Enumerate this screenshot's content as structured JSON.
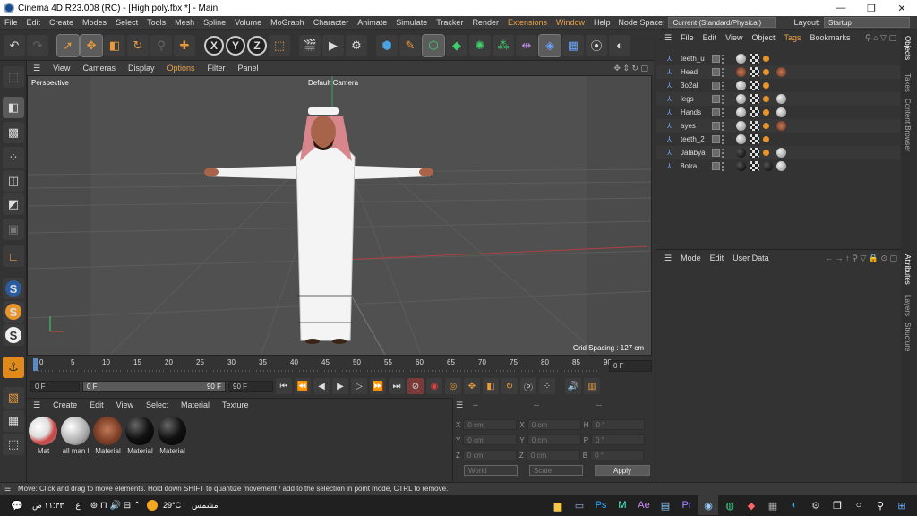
{
  "window": {
    "title": "Cinema 4D R23.008 (RC) - [High poly.fbx *] - Main"
  },
  "menubar": {
    "items": [
      "File",
      "Edit",
      "Create",
      "Modes",
      "Select",
      "Tools",
      "Mesh",
      "Spline",
      "Volume",
      "MoGraph",
      "Character",
      "Animate",
      "Simulate",
      "Tracker",
      "Render",
      "Extensions",
      "Window",
      "Help"
    ],
    "node_space_label": "Node Space:",
    "node_space_value": "Current (Standard/Physical)",
    "layout_label": "Layout:",
    "layout_value": "Startup"
  },
  "viewport": {
    "menu": [
      "View",
      "Cameras",
      "Display",
      "Options",
      "Filter",
      "Panel"
    ],
    "label": "Perspective",
    "camera": "Default Camera",
    "grid_spacing": "Grid Spacing : 127 cm"
  },
  "timeline": {
    "ticks": [
      "0",
      "5",
      "10",
      "15",
      "20",
      "25",
      "30",
      "35",
      "40",
      "45",
      "50",
      "55",
      "60",
      "65",
      "70",
      "75",
      "80",
      "85",
      "90"
    ],
    "current_frame": "0 F"
  },
  "transport": {
    "start": "0 F",
    "range_start": "0 F",
    "range_end": "90 F",
    "end": "90 F"
  },
  "materials": {
    "menu": [
      "Create",
      "Edit",
      "View",
      "Select",
      "Material",
      "Texture"
    ],
    "items": [
      {
        "label": "Mat",
        "kind": "white-red"
      },
      {
        "label": "all man l",
        "kind": "grey"
      },
      {
        "label": "Material",
        "kind": "face"
      },
      {
        "label": "Material",
        "kind": "black"
      },
      {
        "label": "Material",
        "kind": "black"
      }
    ]
  },
  "coordinates": {
    "header_dashes": [
      "--",
      "--",
      "--"
    ],
    "rows": [
      {
        "a": "X",
        "av": "0 cm",
        "b": "X",
        "bv": "0 cm",
        "c": "H",
        "cv": "0 °"
      },
      {
        "a": "Y",
        "av": "0 cm",
        "b": "Y",
        "bv": "0 cm",
        "c": "P",
        "cv": "0 °"
      },
      {
        "a": "Z",
        "av": "0 cm",
        "b": "Z",
        "bv": "0 cm",
        "c": "B",
        "cv": "0 °"
      }
    ],
    "world": "World",
    "scale": "Scale",
    "apply": "Apply"
  },
  "objects": {
    "menu": [
      "File",
      "Edit",
      "View",
      "Object",
      "Tags",
      "Bookmarks"
    ],
    "rows": [
      {
        "name": "teeth_u",
        "tags": [
          "grey",
          "check",
          "orange"
        ]
      },
      {
        "name": "Head",
        "tags": [
          "face",
          "check",
          "orange",
          "face"
        ]
      },
      {
        "name": "3o2al",
        "tags": [
          "grey",
          "check",
          "orange"
        ]
      },
      {
        "name": "legs",
        "tags": [
          "grey",
          "check",
          "orange",
          "grey"
        ]
      },
      {
        "name": "Hands",
        "tags": [
          "grey",
          "check",
          "orange",
          "grey"
        ]
      },
      {
        "name": "ayes",
        "tags": [
          "grey",
          "check",
          "orange",
          "face"
        ]
      },
      {
        "name": "teeth_2",
        "tags": [
          "grey",
          "check",
          "orange"
        ]
      },
      {
        "name": "Jalabya",
        "tags": [
          "black",
          "check",
          "orange",
          "grey"
        ]
      },
      {
        "name": "8otra",
        "tags": [
          "black",
          "check",
          "black",
          "grey"
        ]
      }
    ]
  },
  "attributes": {
    "menu": [
      "Mode",
      "Edit",
      "User Data"
    ]
  },
  "side_tabs": {
    "top": [
      "Objects",
      "Takes",
      "Content Browser"
    ],
    "bottom": [
      "Attributes",
      "Layers",
      "Structure"
    ]
  },
  "status": {
    "text": "Move: Click and drag to move elements. Hold down SHIFT to quantize movement / add to the selection in point mode, CTRL to remove."
  },
  "taskbar": {
    "time": "١١:٣٣ ص",
    "lang": "ع",
    "weather_temp": "29°C",
    "weather_text": "مشمس"
  }
}
